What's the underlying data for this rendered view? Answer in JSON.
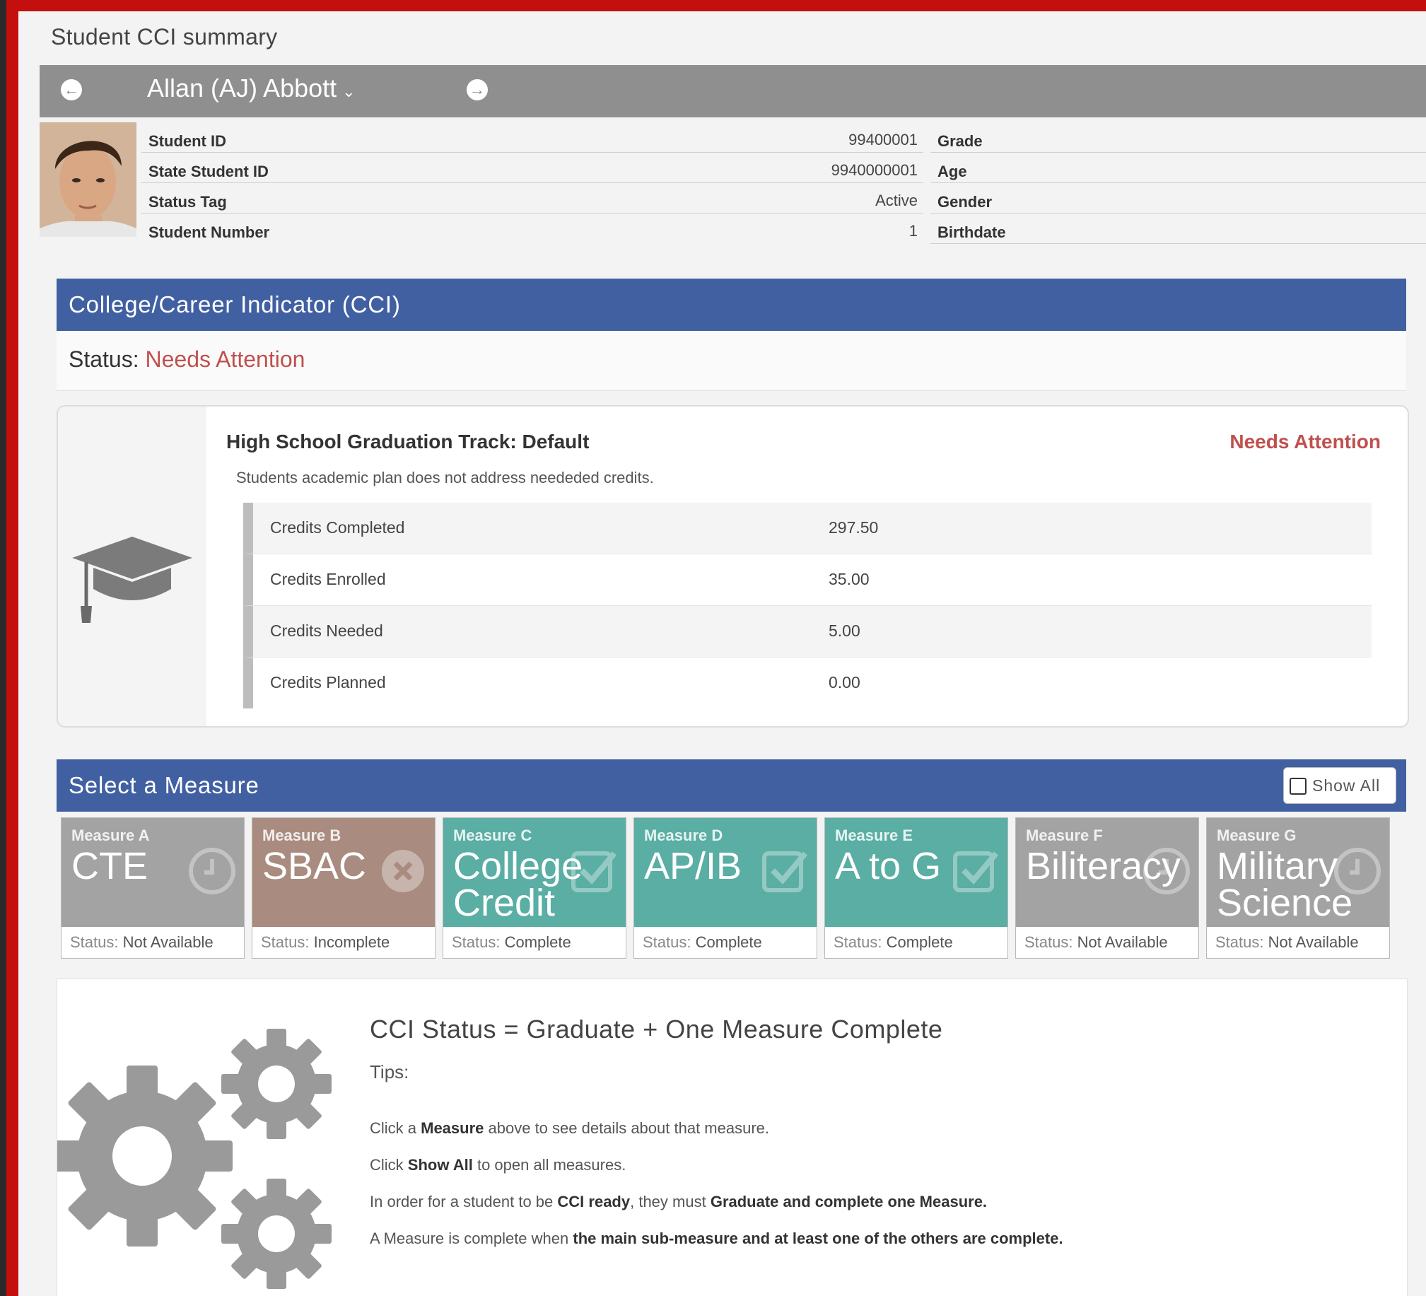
{
  "page": {
    "title": "Student CCI summary"
  },
  "student": {
    "name": "Allan (AJ) Abbott",
    "left": [
      {
        "label": "Student ID",
        "value": "99400001"
      },
      {
        "label": "State Student ID",
        "value": "9940000001"
      },
      {
        "label": "Status Tag",
        "value": "Active"
      },
      {
        "label": "Student Number",
        "value": "1"
      }
    ],
    "right": [
      {
        "label": "Grade",
        "value": ""
      },
      {
        "label": "Age",
        "value": ""
      },
      {
        "label": "Gender",
        "value": ""
      },
      {
        "label": "Birthdate",
        "value": ""
      }
    ]
  },
  "cci": {
    "header": "College/Career Indicator (CCI)",
    "status_label": "Status:",
    "status_value": "Needs Attention",
    "status_color": "#c0504d"
  },
  "graduation": {
    "title": "High School Graduation Track: Default",
    "status": "Needs Attention",
    "description": "Students academic plan does not address neededed credits.",
    "credits": [
      {
        "label": "Credits Completed",
        "value": "297.50"
      },
      {
        "label": "Credits Enrolled",
        "value": "35.00"
      },
      {
        "label": "Credits Needed",
        "value": "5.00"
      },
      {
        "label": "Credits Planned",
        "value": "0.00"
      }
    ]
  },
  "measures": {
    "header": "Select a Measure",
    "show_all": "Show All",
    "status_prefix": "Status:",
    "items": [
      {
        "code": "Measure A",
        "name": "CTE",
        "status": "Not Available",
        "color": "#a3a3a3",
        "icon": "clock-icon"
      },
      {
        "code": "Measure B",
        "name": "SBAC",
        "status": "Incomplete",
        "color": "#a98c7f",
        "icon": "x-circle-icon"
      },
      {
        "code": "Measure C",
        "name": "College Credit",
        "status": "Complete",
        "color": "#5aaea4",
        "icon": "check-icon"
      },
      {
        "code": "Measure D",
        "name": "AP/IB",
        "status": "Complete",
        "color": "#5aaea4",
        "icon": "check-icon"
      },
      {
        "code": "Measure E",
        "name": "A to G",
        "status": "Complete",
        "color": "#5aaea4",
        "icon": "check-icon"
      },
      {
        "code": "Measure F",
        "name": "Biliteracy",
        "status": "Not Available",
        "color": "#a3a3a3",
        "icon": "clock-icon"
      },
      {
        "code": "Measure G",
        "name": "Military Science",
        "status": "Not Available",
        "color": "#a3a3a3",
        "icon": "clock-icon"
      }
    ]
  },
  "tips": {
    "title": "CCI Status = Graduate + One Measure Complete",
    "label": "Tips:",
    "t1a": "Click a ",
    "t1b": "Measure",
    "t1c": " above to see details about that measure.",
    "t2a": "Click ",
    "t2b": "Show All",
    "t2c": " to open all measures.",
    "t3a": "In order for a student to be ",
    "t3b": "CCI ready",
    "t3c": ", they must ",
    "t3d": "Graduate and complete one Measure.",
    "t4a": "A Measure is complete when ",
    "t4b": "the main sub-measure and at least one of the others are complete."
  }
}
